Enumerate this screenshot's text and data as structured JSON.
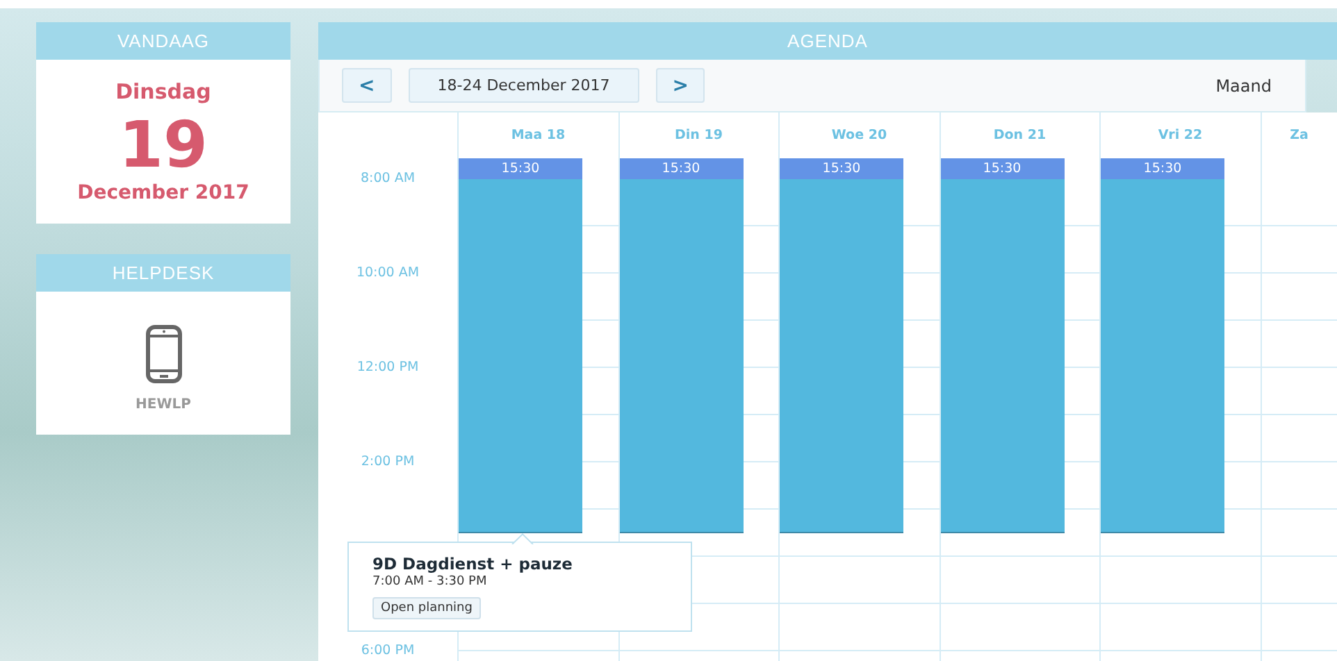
{
  "today": {
    "title": "VANDAAG",
    "weekday": "Dinsdag",
    "day": "19",
    "month": "December 2017"
  },
  "helpdesk": {
    "title": "HELPDESK",
    "label": "HEWLP"
  },
  "agenda": {
    "title": "AGENDA",
    "prev": "<",
    "range": "18-24 December 2017",
    "next": ">",
    "view": "Maand",
    "time_rows": [
      {
        "label": "8:00 AM"
      },
      {
        "label": "10:00 AM"
      },
      {
        "label": "12:00 PM"
      },
      {
        "label": "2:00 PM"
      },
      {},
      {
        "label": "6:00 PM"
      }
    ],
    "days": [
      {
        "label": "Maa 18",
        "events": [
          {
            "time": "15:30"
          }
        ]
      },
      {
        "label": "Din 19",
        "events": [
          {
            "time": "15:30"
          }
        ]
      },
      {
        "label": "Woe 20",
        "events": [
          {
            "time": "15:30"
          }
        ]
      },
      {
        "label": "Don 21",
        "events": [
          {
            "time": "15:30"
          }
        ]
      },
      {
        "label": "Vri 22",
        "events": [
          {
            "time": "15:30"
          }
        ]
      },
      {
        "label": "Za"
      }
    ],
    "popover": {
      "title": "9D Dagdienst + pauze",
      "time": "7:00 AM - 3:30 PM",
      "button": "Open planning"
    }
  }
}
